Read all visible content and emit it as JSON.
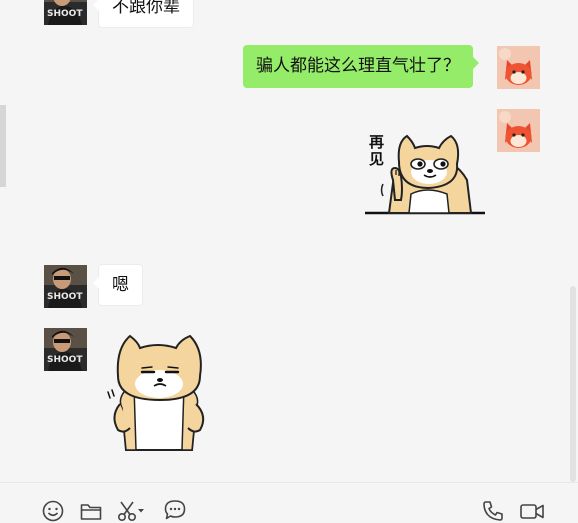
{
  "messages": [
    {
      "id": "m1",
      "side": "incoming",
      "text": "不跟你辈",
      "avatar": "contact-avatar"
    },
    {
      "id": "m2",
      "side": "outgoing",
      "text": "骗人都能这么理直气壮了？",
      "avatar": "self-avatar"
    },
    {
      "id": "m3",
      "side": "outgoing",
      "type": "sticker",
      "sticker": "shiba-wave-goodbye",
      "text": "再见",
      "avatar": "self-avatar"
    },
    {
      "id": "m4",
      "side": "incoming",
      "text": "嗯",
      "avatar": "contact-avatar"
    },
    {
      "id": "m5",
      "side": "incoming",
      "type": "sticker",
      "sticker": "shiba-smug-hands-on-hips",
      "avatar": "contact-avatar"
    }
  ],
  "contact_avatar": {
    "text": "SHOOT"
  },
  "toolbar": {
    "left": [
      {
        "icon": "emoji-icon"
      },
      {
        "icon": "folder-icon"
      },
      {
        "icon": "scissors-icon"
      },
      {
        "icon": "chevron-down-icon"
      },
      {
        "icon": "chat-bubble-icon"
      }
    ],
    "right": [
      {
        "icon": "phone-icon"
      },
      {
        "icon": "video-call-icon"
      }
    ]
  },
  "colors": {
    "outgoing_bubble": "#95ec69",
    "incoming_bubble": "#ffffff",
    "background": "#f5f5f5"
  }
}
